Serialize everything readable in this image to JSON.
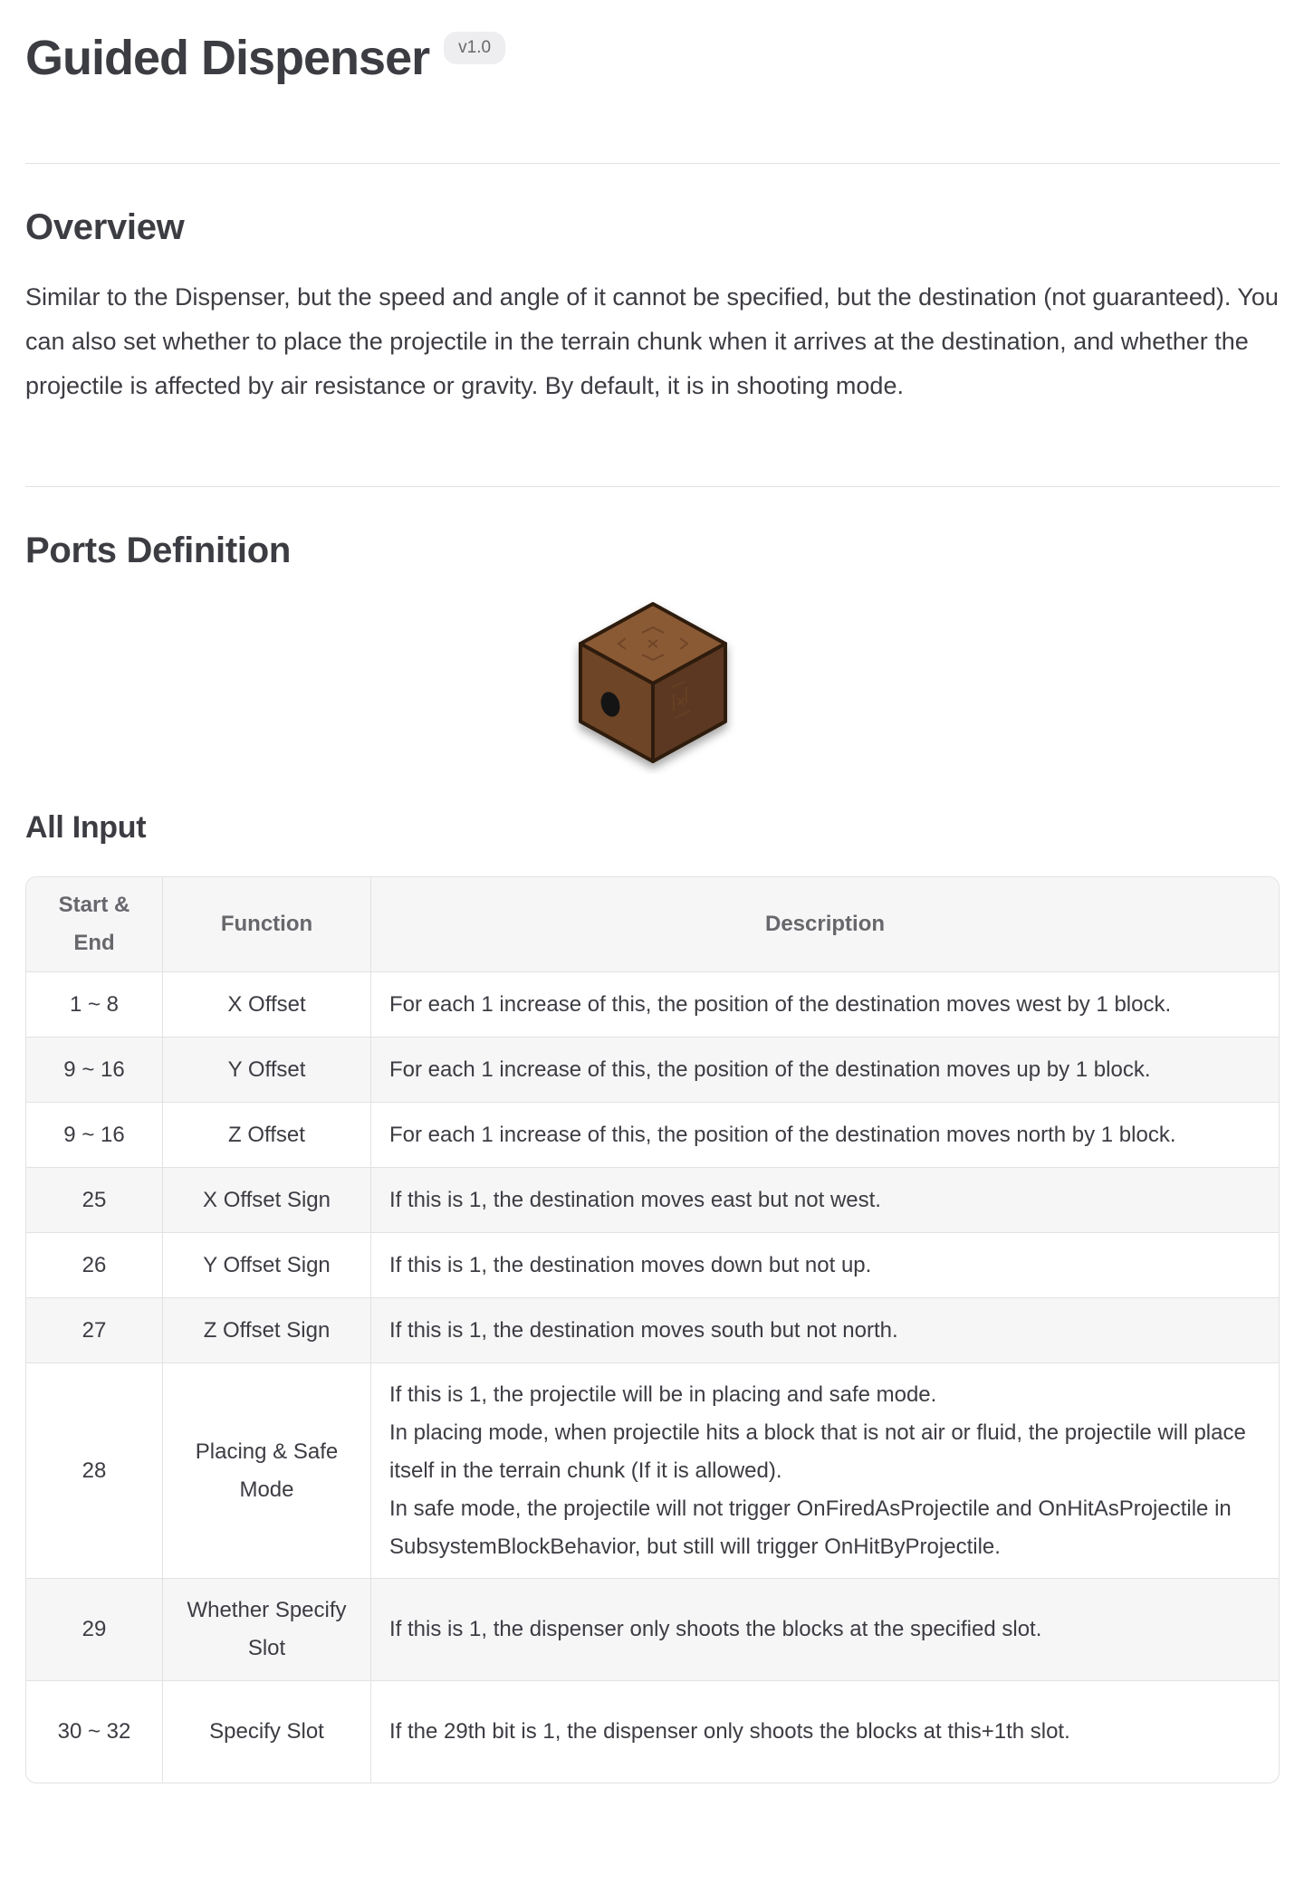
{
  "page": {
    "title": "Guided Dispenser",
    "version_badge": "v1.0"
  },
  "overview": {
    "heading": "Overview",
    "text": "Similar to the Dispenser, but the speed and angle of it cannot be specified, but the destination (not guaranteed). You can also set whether to place the projectile in the terrain chunk when it arrives at the destination, and whether the projectile is affected by air resistance or gravity. By default, it is in shooting mode."
  },
  "ports": {
    "heading": "Ports Definition",
    "image_icon": "guided-dispenser-block-icon",
    "colors": {
      "wood_top": "#8a5a36",
      "wood_left": "#6e4527",
      "wood_right": "#5b3920",
      "outline": "#2e1a0c",
      "hole": "#141414"
    }
  },
  "all_input": {
    "heading": "All Input",
    "headers": [
      "Start & End",
      "Function",
      "Description"
    ],
    "rows": [
      {
        "range": "1 ~ 8",
        "function": "X Offset",
        "description": [
          "For each 1 increase of this, the position of the destination moves west by 1 block."
        ]
      },
      {
        "range": "9 ~ 16",
        "function": "Y Offset",
        "description": [
          "For each 1 increase of this, the position of the destination moves up by 1 block."
        ]
      },
      {
        "range": "9 ~ 16",
        "function": "Z Offset",
        "description": [
          "For each 1 increase of this, the position of the destination moves north by 1 block."
        ]
      },
      {
        "range": "25",
        "function": "X Offset Sign",
        "description": [
          "If this is 1, the destination moves east but not west."
        ]
      },
      {
        "range": "26",
        "function": "Y Offset Sign",
        "description": [
          "If this is 1, the destination moves down but not up."
        ]
      },
      {
        "range": "27",
        "function": "Z Offset Sign",
        "description": [
          "If this is 1, the destination moves south but not north."
        ]
      },
      {
        "range": "28",
        "function": "Placing & Safe Mode",
        "description": [
          "If this is 1, the projectile will be in placing and safe mode.",
          "In placing mode, when projectile hits a block that is not air or fluid, the projectile will place itself in the terrain chunk (If it is allowed).",
          "In safe mode, the projectile will not trigger OnFiredAsProjectile and OnHitAsProjectile in SubsystemBlockBehavior, but still will trigger OnHitByProjectile."
        ]
      },
      {
        "range": "29",
        "function": "Whether Specify Slot",
        "description": [
          "If this is 1, the dispenser only shoots the blocks at the specified slot."
        ]
      },
      {
        "range": "30 ~ 32",
        "function": "Specify Slot",
        "description": [
          "If the 29th bit is 1, the dispenser only shoots the blocks at this+1th slot."
        ]
      }
    ]
  }
}
